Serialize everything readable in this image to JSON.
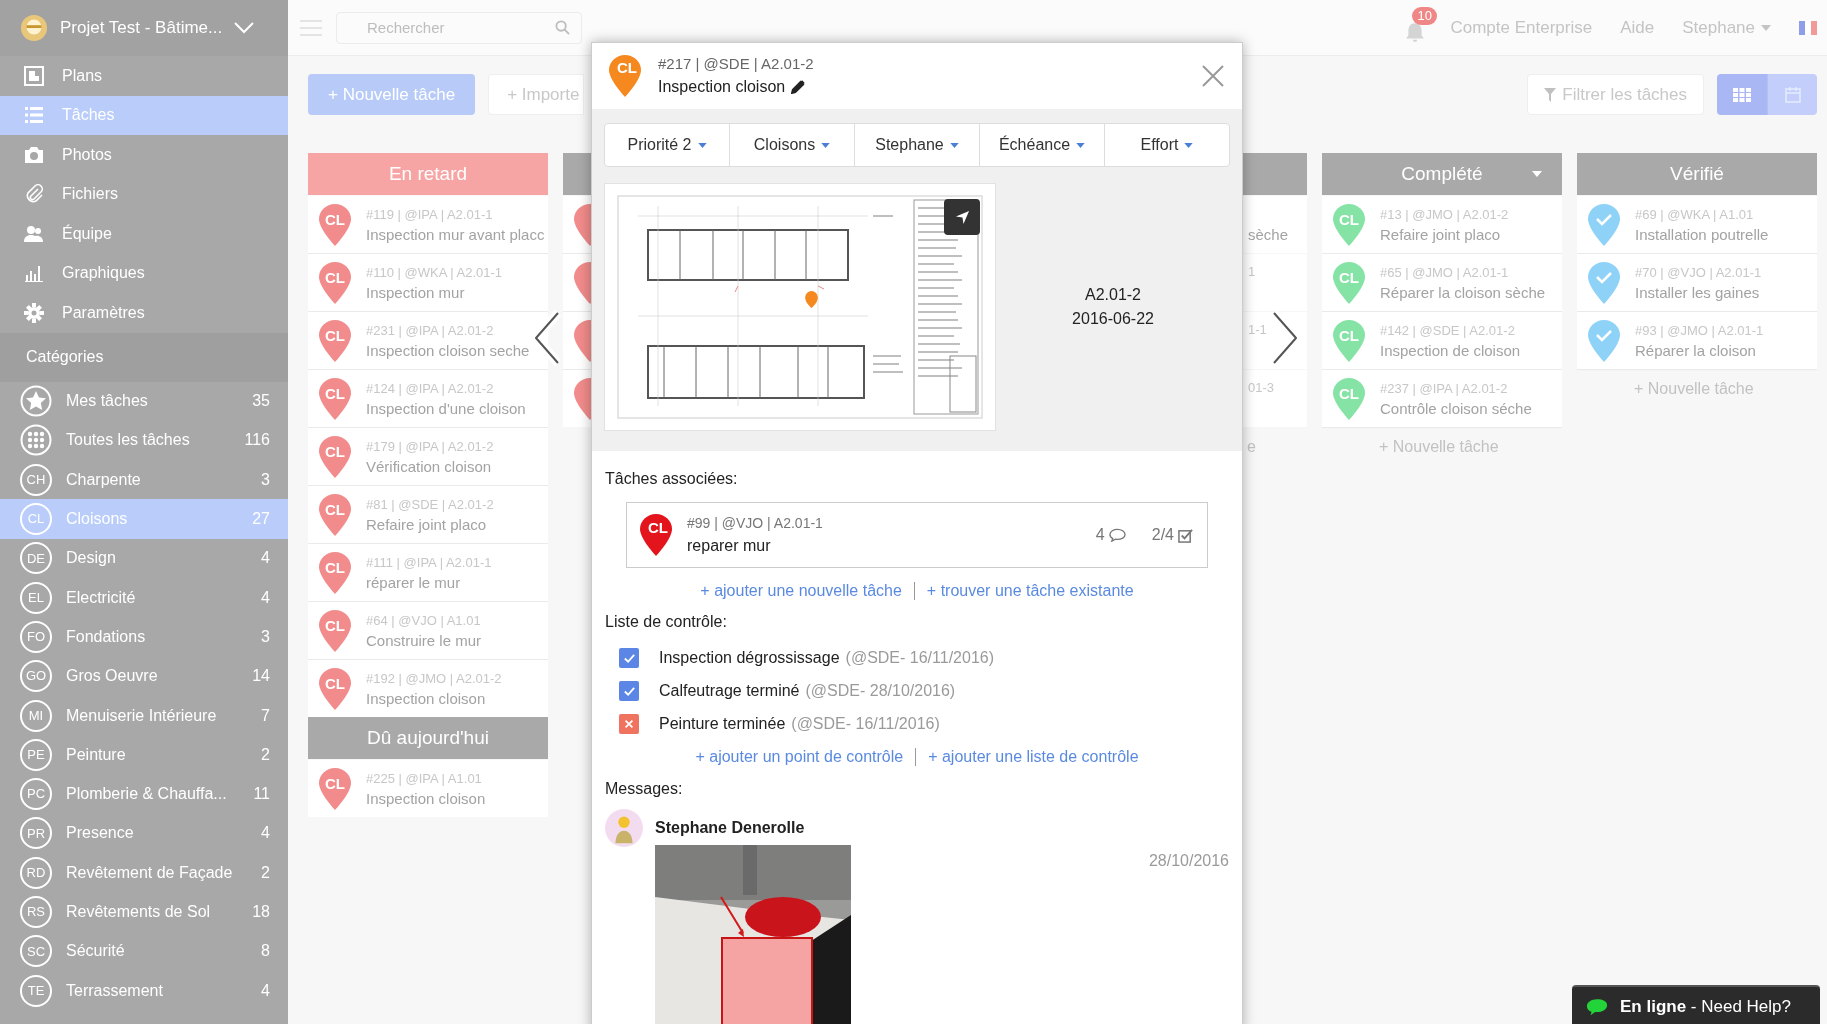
{
  "sidebar": {
    "project": "Projet Test - Bâtime...",
    "nav": [
      {
        "kind": "plans",
        "label": "Plans",
        "selected": false
      },
      {
        "kind": "list",
        "label": "Tâches",
        "selected": true
      },
      {
        "kind": "camera",
        "label": "Photos",
        "selected": false
      },
      {
        "kind": "clip",
        "label": "Fichiers",
        "selected": false
      },
      {
        "kind": "team",
        "label": "Équipe",
        "selected": false
      },
      {
        "kind": "chart",
        "label": "Graphiques",
        "selected": false
      },
      {
        "kind": "gear",
        "label": "Paramètres",
        "selected": false
      }
    ],
    "categories_heading": "Catégories",
    "categories": [
      {
        "kind": "star",
        "label": "Mes tâches",
        "count": "35",
        "selected": false
      },
      {
        "kind": "all",
        "label": "Toutes les tâches",
        "count": "116",
        "selected": false
      },
      {
        "kind": "abbr",
        "abbr": "CH",
        "label": "Charpente",
        "count": "3",
        "selected": false
      },
      {
        "kind": "abbr",
        "abbr": "CL",
        "label": "Cloisons",
        "count": "27",
        "selected": true
      },
      {
        "kind": "abbr",
        "abbr": "DE",
        "label": "Design",
        "count": "4",
        "selected": false
      },
      {
        "kind": "abbr",
        "abbr": "EL",
        "label": "Electricité",
        "count": "4",
        "selected": false
      },
      {
        "kind": "abbr",
        "abbr": "FO",
        "label": "Fondations",
        "count": "3",
        "selected": false
      },
      {
        "kind": "abbr",
        "abbr": "GO",
        "label": "Gros Oeuvre",
        "count": "14",
        "selected": false
      },
      {
        "kind": "abbr",
        "abbr": "MI",
        "label": "Menuiserie Intérieure",
        "count": "7",
        "selected": false
      },
      {
        "kind": "abbr",
        "abbr": "PE",
        "label": "Peinture",
        "count": "2",
        "selected": false
      },
      {
        "kind": "abbr",
        "abbr": "PC",
        "label": "Plomberie & Chauffa...",
        "count": "11",
        "selected": false
      },
      {
        "kind": "abbr",
        "abbr": "PR",
        "label": "Presence",
        "count": "4",
        "selected": false
      },
      {
        "kind": "abbr",
        "abbr": "RD",
        "label": "Revêtement de Façade",
        "count": "2",
        "selected": false
      },
      {
        "kind": "abbr",
        "abbr": "RS",
        "label": "Revêtements de Sol",
        "count": "18",
        "selected": false
      },
      {
        "kind": "abbr",
        "abbr": "SC",
        "label": "Sécurité",
        "count": "8",
        "selected": false
      },
      {
        "kind": "abbr",
        "abbr": "TE",
        "label": "Terrassement",
        "count": "4",
        "selected": false
      }
    ]
  },
  "topbar": {
    "search_placeholder": "Rechercher",
    "notifications": "10",
    "links": [
      "Compte Enterprise",
      "Aide"
    ],
    "user": "Stephane"
  },
  "toolbar": {
    "new_task": "+ Nouvelle tâche",
    "import": "+ Importe",
    "filter": "Filtrer les tâches",
    "views": [
      {
        "kind": "board",
        "selected": true
      },
      {
        "kind": "calendar",
        "selected": false
      }
    ]
  },
  "columns": [
    {
      "kind": "full",
      "color": "#f28b8b",
      "groups": [
        {
          "title": "En retard",
          "color": "#f7a4a4",
          "cards": [
            {
              "pin": "CL",
              "meta": "#119 | @IPA | A2.01-1",
              "title": "Inspection mur avant placc"
            },
            {
              "pin": "CL",
              "meta": "#110 | @WKA | A2.01-1",
              "title": "Inspection mur"
            },
            {
              "pin": "CL",
              "meta": "#231 | @IPA | A2.01-2",
              "title": "Inspection cloison seche"
            },
            {
              "pin": "CL",
              "meta": "#124 | @IPA | A2.01-2",
              "title": "Inspection d'une cloison"
            },
            {
              "pin": "CL",
              "meta": "#179 | @IPA | A2.01-2",
              "title": "Vérification cloison"
            },
            {
              "pin": "CL",
              "meta": "#81 | @SDE | A2.01-2",
              "title": "Refaire joint placo"
            },
            {
              "pin": "CL",
              "meta": "#111 | @IPA | A2.01-1",
              "title": "réparer le mur"
            },
            {
              "pin": "CL",
              "meta": "#64 | @VJO | A1.01",
              "title": "Construire le mur"
            },
            {
              "pin": "CL",
              "meta": "#192 | @JMO | A2.01-2",
              "title": "Inspection cloison"
            }
          ]
        },
        {
          "title": "Dû aujourd'hui",
          "color": "#a9a9a9",
          "cards": [
            {
              "pin": "CL",
              "meta": "#225 | @IPA | A1.01",
              "title": "Inspection cloison"
            }
          ]
        }
      ]
    },
    {
      "kind": "peek",
      "color": "#f28b8b",
      "groups": [
        {
          "color": "#a9a9a9",
          "cards": [
            {
              "kind": "label"
            },
            {
              "kind": "label"
            },
            {
              "kind": "label"
            },
            {
              "kind": "label"
            }
          ]
        }
      ]
    },
    {
      "kind": "hidden"
    },
    {
      "kind": "peek",
      "groups": [
        {
          "color": "#a9a9a9",
          "cards": [
            {
              "title": "sèche"
            },
            {
              "meta": "1"
            },
            {
              "meta": "1-1"
            },
            {
              "meta": "01-3"
            }
          ]
        }
      ],
      "add_label": "e"
    },
    {
      "kind": "full",
      "color": "#86e3a6",
      "menu": true,
      "groups": [
        {
          "title": "Complété",
          "color": "#a9a9a9",
          "cards": [
            {
              "pin": "CL",
              "meta": "#13 | @JMO | A2.01-2",
              "title": "Refaire joint placo"
            },
            {
              "pin": "CL",
              "meta": "#65 | @JMO | A2.01-1",
              "title": "Réparer la cloison sèche"
            },
            {
              "pin": "CL",
              "meta": "#142 | @SDE | A2.01-2",
              "title": "Inspection de cloison"
            },
            {
              "pin": "CL",
              "meta": "#237 | @IPA | A2.01-2",
              "title": "Contrôle cloison séche"
            }
          ]
        }
      ],
      "add_label": "+ Nouvelle tâche"
    },
    {
      "kind": "full",
      "color": "#8fd2f7",
      "groups": [
        {
          "title": "Vérifié",
          "color": "#a9a9a9",
          "cards": [
            {
              "kind": "check",
              "meta": "#69 | @WKA | A1.01",
              "title": "Installation poutrelle"
            },
            {
              "kind": "check",
              "meta": "#70 | @VJO | A2.01-1",
              "title": "Installer les gaines"
            },
            {
              "kind": "check",
              "meta": "#93 | @JMO | A2.01-1",
              "title": "Réparer la cloison"
            }
          ]
        }
      ],
      "add_label": "+ Nouvelle tâche"
    }
  ],
  "modal": {
    "pin": "CL",
    "color": "#f5891f",
    "meta": "#217 | @SDE | A2.01-2",
    "title": "Inspection cloison",
    "dropdowns": [
      "Priorité 2",
      "Cloisons",
      "Stephane",
      "Échéance",
      "Effort"
    ],
    "plan": {
      "sheet": "A2.01-2",
      "date": "2016-06-22"
    },
    "related_heading": "Tâches associées:",
    "related": [
      {
        "pin": "CL",
        "color": "#e3141b",
        "meta": "#99 | @VJO | A2.01-1",
        "title": "reparer mur",
        "comments": "4",
        "checklist": "2/4"
      }
    ],
    "related_links": [
      "+ ajouter une nouvelle tâche",
      "+ trouver une tâche existante"
    ],
    "checklist_heading": "Liste de contrôle:",
    "checklist": [
      {
        "label": "Inspection dégrossissage",
        "info": "(@SDE- 16/11/2016)",
        "kind": "done"
      },
      {
        "label": "Calfeutrage terminé",
        "info": "(@SDE- 28/10/2016)",
        "kind": "done"
      },
      {
        "label": "Peinture terminée",
        "info": "(@SDE- 16/11/2016)",
        "kind": "failed"
      }
    ],
    "checklist_links": [
      "+ ajouter un point de contrôle",
      "+ ajouter une liste de contrôle"
    ],
    "messages_heading": "Messages:",
    "messages": [
      {
        "author": "Stephane Denerolle",
        "date": "28/10/2016"
      }
    ]
  },
  "chat": {
    "label": "**En ligne** - Need Help?"
  }
}
